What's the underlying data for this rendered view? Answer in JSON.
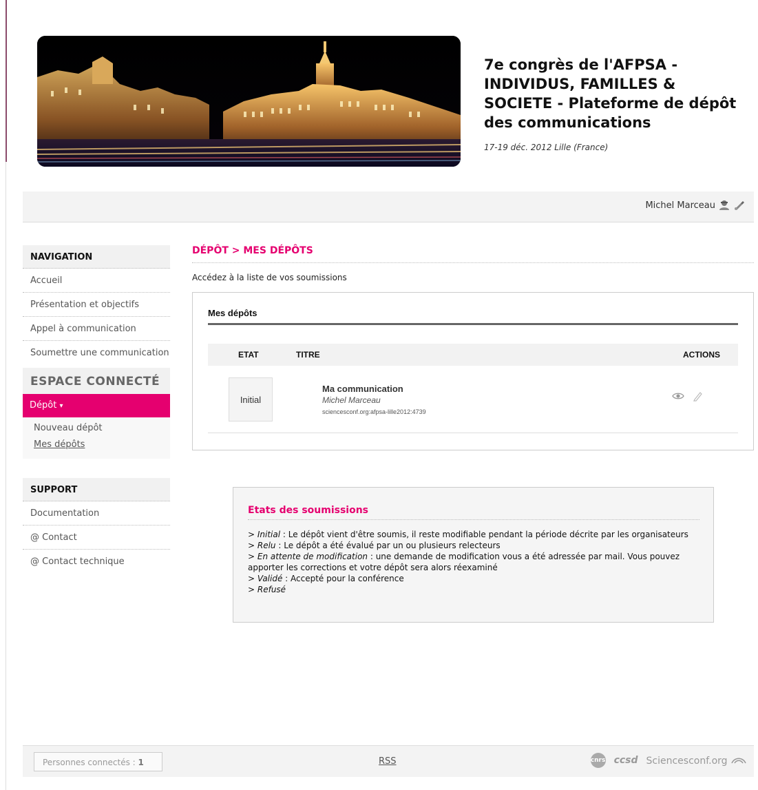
{
  "header": {
    "title": "7e congrès de l'AFPSA - INDIVIDUS, FAMILLES & SOCIETE - Plateforme de dépôt des communications",
    "date": "17-19 déc. 2012 Lille (France)"
  },
  "userbar": {
    "username": "Michel Marceau",
    "icons": [
      "user-icon",
      "logout-icon"
    ]
  },
  "sidebar": {
    "navigation_title": "NAVIGATION",
    "navigation_items": [
      "Accueil",
      "Présentation et objectifs",
      "Appel à communication",
      "Soumettre une communication"
    ],
    "espace_title": "ESPACE CONNECTÉ",
    "depot_label": "Dépôt",
    "depot_arrow": "▾",
    "sub_items": [
      "Nouveau dépôt",
      "Mes dépôts"
    ],
    "support_title": "SUPPORT",
    "support_items": [
      "Documentation",
      "@ Contact",
      "@ Contact technique"
    ]
  },
  "main": {
    "breadcrumb": "DÉPÔT > MES DÉPÔTS",
    "intro": "Accédez à la liste de vos soumissions",
    "box_title": "Mes dépôts",
    "columns": {
      "etat": "ETAT",
      "titre": "TITRE",
      "actions": "ACTIONS"
    },
    "rows": [
      {
        "etat": "Initial",
        "title": "Ma communication",
        "author": "Michel Marceau",
        "ref": "sciencesconf.org:afpsa-lille2012:4739",
        "actions": [
          "view-icon",
          "edit-icon"
        ]
      }
    ]
  },
  "legend": {
    "title": "Etats des soumissions",
    "items": [
      {
        "prefix": "> ",
        "term": "Initial",
        "text": " : Le dépôt vient d'être soumis, il reste modifiable pendant la période décrite par les organisateurs"
      },
      {
        "prefix": "> ",
        "term": "Relu",
        "text": " : Le dépôt a été évalué par un ou plusieurs relecteurs"
      },
      {
        "prefix": "> ",
        "term": "En attente de modification",
        "text": " : une demande de modification vous a été adressée par mail. Vous pouvez apporter les corrections et votre dépôt sera alors réexaminé"
      },
      {
        "prefix": "> ",
        "term": "Validé",
        "text": " : Accepté pour la conférence"
      },
      {
        "prefix": "> ",
        "term": "Refusé",
        "text": ""
      }
    ]
  },
  "footer": {
    "online_label": "Personnes connectés :",
    "online_count": "1",
    "rss": "RSS",
    "logo_cnrs": "cnrs",
    "logo_ccsd": "ccsd",
    "logo_sciencesconf": "Sciencesconf.org"
  },
  "colors": {
    "accent": "#e5006f",
    "panel": "#f1f1f1"
  }
}
